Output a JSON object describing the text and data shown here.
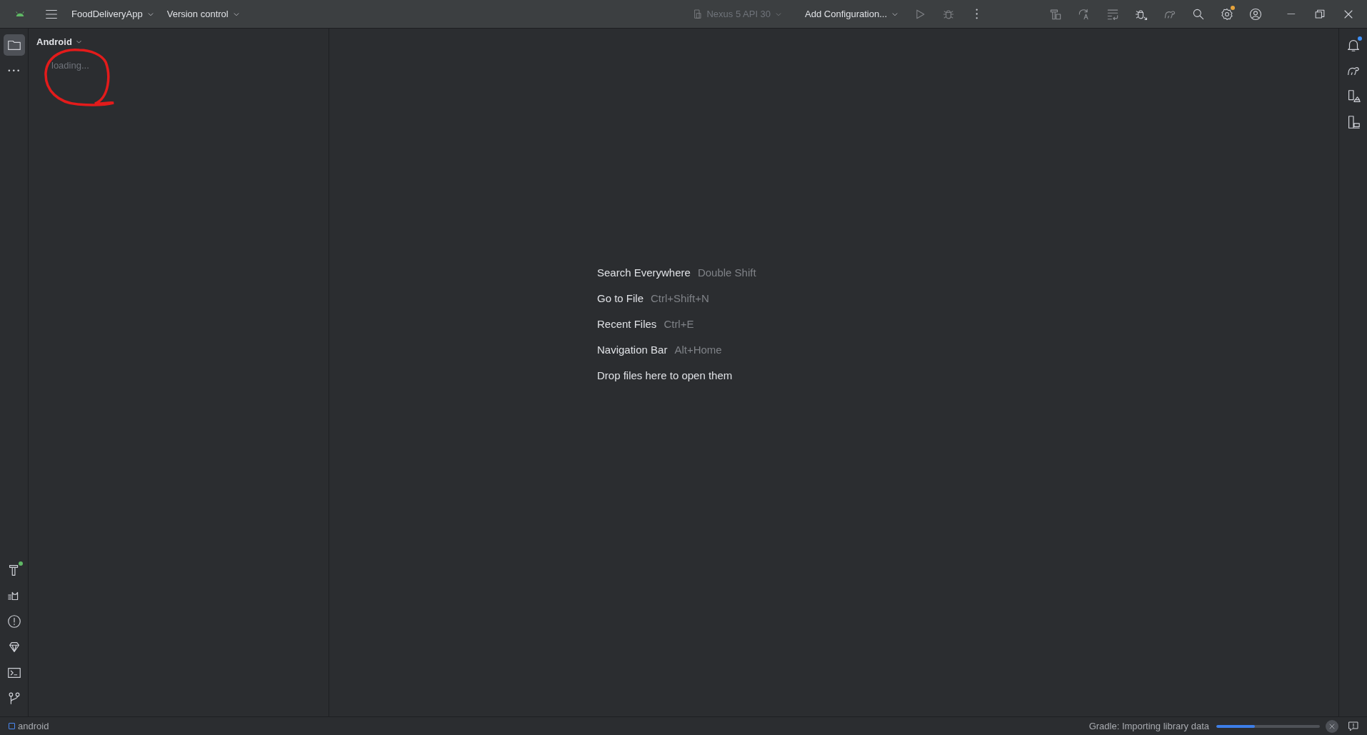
{
  "title_bar": {
    "project": "FoodDeliveryApp",
    "vcs": "Version control",
    "device": {
      "label": "Nexus 5 API 30",
      "disabled": true
    },
    "run_config": "Add Configuration...",
    "settings_update": true
  },
  "left_strip": {
    "top": [
      {
        "kind": "project",
        "selected": true
      },
      {
        "kind": "more",
        "selected": false
      }
    ],
    "bottom": [
      {
        "kind": "build",
        "selected": false,
        "color": "#5fb865"
      },
      {
        "kind": "logcat",
        "selected": false
      },
      {
        "kind": "problems",
        "selected": false
      },
      {
        "kind": "quality",
        "selected": false
      },
      {
        "kind": "terminal",
        "selected": false
      },
      {
        "kind": "git",
        "selected": false
      }
    ]
  },
  "project_panel": {
    "view": "Android",
    "status": "loading..."
  },
  "editor_hints": [
    {
      "action": "Search Everywhere",
      "shortcut": "Double Shift"
    },
    {
      "action": "Go to File",
      "shortcut": "Ctrl+Shift+N"
    },
    {
      "action": "Recent Files",
      "shortcut": "Ctrl+E"
    },
    {
      "action": "Navigation Bar",
      "shortcut": "Alt+Home"
    },
    {
      "action": "Drop files here to open them"
    }
  ],
  "right_strip": [
    {
      "kind": "notifications",
      "color": "#3d8ff5"
    },
    {
      "kind": "gradle"
    },
    {
      "kind": "device_manager"
    },
    {
      "kind": "running_devices"
    }
  ],
  "status_bar": {
    "module": "android",
    "task": "Gradle: Importing library data",
    "level": 0.37
  }
}
